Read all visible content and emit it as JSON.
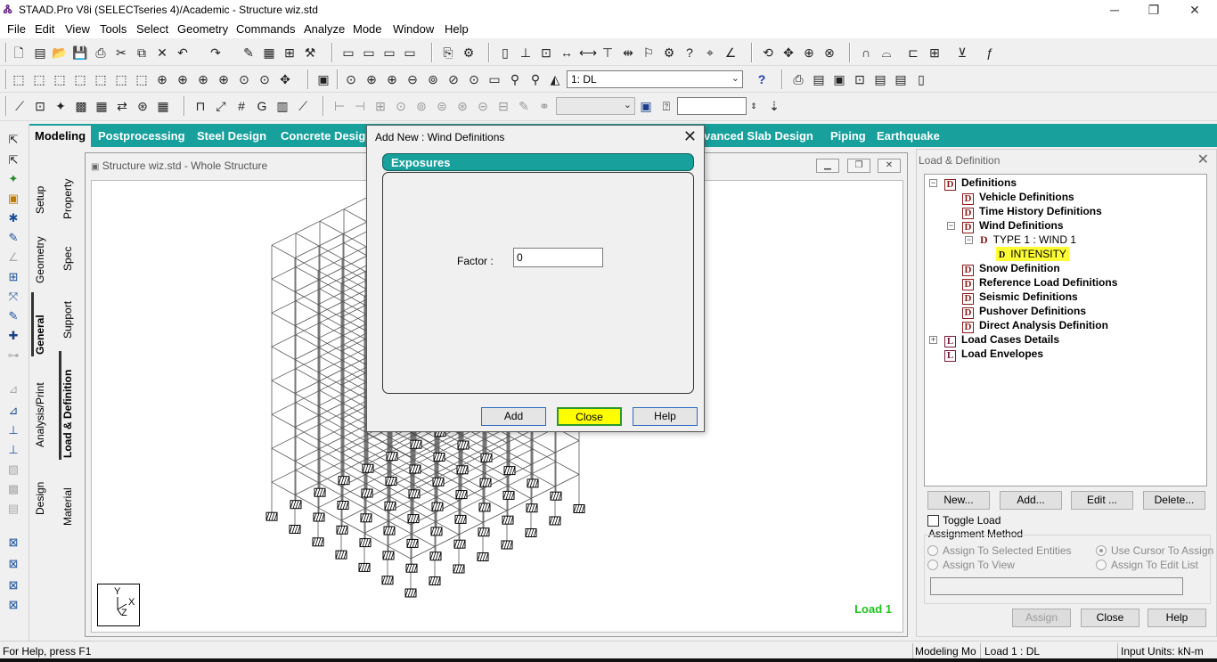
{
  "window": {
    "title": "STAAD.Pro V8i (SELECTseries 4)/Academic - Structure wiz.std",
    "minimize": "─",
    "restore": "❐",
    "close": "✕"
  },
  "menu": [
    "File",
    "Edit",
    "View",
    "Tools",
    "Select",
    "Geometry",
    "Commands",
    "Analyze",
    "Mode",
    "Window",
    "Help"
  ],
  "toolbar": {
    "load_case_combo": "1: DL",
    "help_icon": "?"
  },
  "page_tabs": [
    "Modeling",
    "Postprocessing",
    "Steel Design",
    "Concrete Desig",
    "vanced Slab Design",
    "Piping",
    "Earthquake"
  ],
  "left_tabs_outer": [
    "Setup",
    "Geometry",
    "General",
    "Analysis/Print",
    "Design"
  ],
  "left_tabs_inner": [
    "Property",
    "Spec",
    "Support",
    "Load & Definition",
    "Material"
  ],
  "structure_window": {
    "title": "Structure wiz.std - Whole Structure",
    "load_label": "Load 1",
    "axis": {
      "y": "Y",
      "x": "X",
      "z": "Z"
    }
  },
  "dialog": {
    "title": "Add New : Wind Definitions",
    "section": "Exposures",
    "factor_label": "Factor :",
    "factor_value": "0",
    "add_button": "Add",
    "close_button": "Close",
    "help_button": "Help"
  },
  "right_panel": {
    "title": "Load & Definition",
    "tree": {
      "definitions": "Definitions",
      "vehicle": "Vehicle Definitions",
      "time_history": "Time History Definitions",
      "wind": "Wind Definitions",
      "wind_type": "TYPE 1 : WIND 1",
      "intensity": "INTENSITY",
      "snow": "Snow Definition",
      "reference": "Reference Load Definitions",
      "seismic": "Seismic Definitions",
      "pushover": "Pushover Definitions",
      "direct": "Direct Analysis Definition",
      "load_cases": "Load Cases Details",
      "envelopes": "Load Envelopes"
    },
    "buttons": {
      "new": "New...",
      "add": "Add...",
      "edit": "Edit ...",
      "delete": "Delete..."
    },
    "toggle_load": "Toggle Load",
    "assignment_method": "Assignment Method",
    "assign_selected": "Assign To Selected Entities",
    "use_cursor": "Use Cursor To Assign",
    "assign_view": "Assign To View",
    "assign_edit_list": "Assign To Edit List",
    "assign_button": "Assign",
    "close_button": "Close",
    "help_button": "Help"
  },
  "status": {
    "help": "For Help, press F1",
    "mode": "Modeling Mo",
    "load": "Load 1 : DL",
    "units": "Input Units:  kN-m"
  }
}
